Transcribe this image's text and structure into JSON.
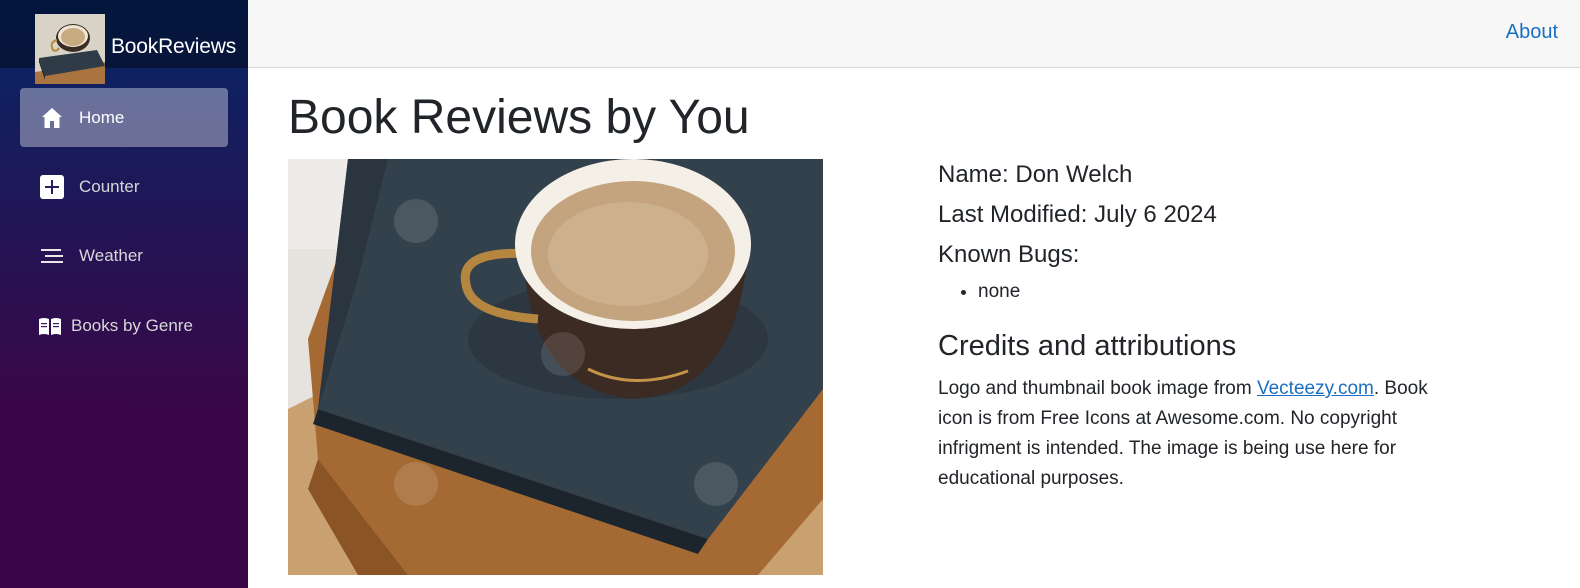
{
  "brand": {
    "name": "BookReviews",
    "logo_icon": "coffee-cup-on-books-photo"
  },
  "sidebar": {
    "items": [
      {
        "label": "Home",
        "icon": "home-icon",
        "active": true
      },
      {
        "label": "Counter",
        "icon": "plus-square-icon",
        "active": false
      },
      {
        "label": "Weather",
        "icon": "list-lines-icon",
        "active": false
      },
      {
        "label": "Books by Genre",
        "icon": "open-book-icon",
        "active": false
      }
    ]
  },
  "topbar": {
    "about_label": "About"
  },
  "main": {
    "title": "Book Reviews by You",
    "image_alt": "coffee-cup-on-books-photo",
    "name_line": "Name: Don Welch",
    "modified_line": "Last Modified: July 6 2024",
    "bugs_heading": "Known Bugs:",
    "bugs": [
      "none"
    ],
    "credits_heading": "Credits and attributions",
    "credits_before_link": "Logo and thumbnail book image from ",
    "credits_link_text": "Vecteezy.com",
    "credits_after_link": ". Book icon is from Free Icons at Awesome.com. No copyright infrigment is intended. The image is being use here for educational purposes."
  },
  "colors": {
    "sidebar_top": "#052767",
    "sidebar_bottom": "#3a0647",
    "link": "#1b6ec2",
    "topbar_bg": "#f7f7f7"
  }
}
